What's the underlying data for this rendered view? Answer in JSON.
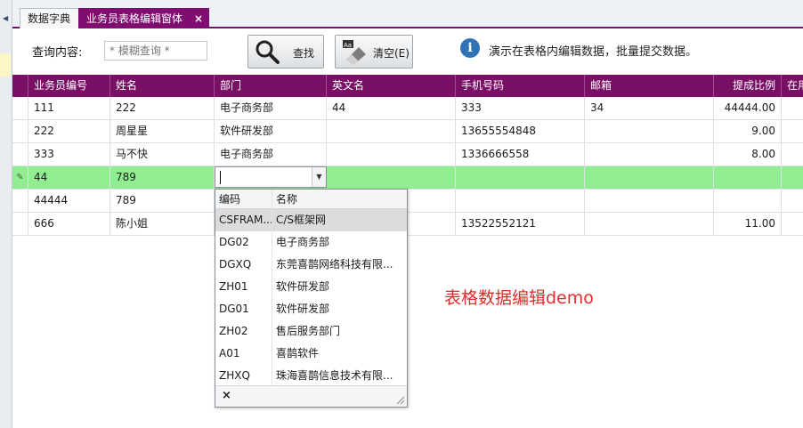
{
  "tabs": [
    {
      "label": "数据字典",
      "active": false
    },
    {
      "label": "业务员表格编辑窗体",
      "active": true,
      "close": "×"
    }
  ],
  "toolbar": {
    "query_label": "查询内容:",
    "query_placeholder": "* 模糊查询 *",
    "find_label": "查找",
    "clear_label": "清空(E)",
    "info_icon": "i",
    "info_text": "演示在表格内编辑数据，批量提交数据。"
  },
  "grid": {
    "columns": [
      "业务员编号",
      "姓名",
      "部门",
      "英文名",
      "手机号码",
      "邮箱",
      "提成比例",
      "在用"
    ],
    "rows": [
      {
        "id": "111",
        "name": "222",
        "dept": "电子商务部",
        "en": "44",
        "phone": "333",
        "email": "34",
        "rate": "44444.00",
        "inuse": ""
      },
      {
        "id": "222",
        "name": "周星星",
        "dept": "软件研发部",
        "en": "",
        "phone": "13655554848",
        "email": "",
        "rate": "9.00",
        "inuse": ""
      },
      {
        "id": "333",
        "name": "马不快",
        "dept": "电子商务部",
        "en": "",
        "phone": "1336666558",
        "email": "",
        "rate": "8.00",
        "inuse": ""
      },
      {
        "id": "44",
        "name": "789",
        "dept": "",
        "en": "",
        "phone": "",
        "email": "",
        "rate": "",
        "inuse": "",
        "editing": true
      },
      {
        "id": "44444",
        "name": "789",
        "dept": "",
        "en": "",
        "phone": "",
        "email": "",
        "rate": "",
        "inuse": ""
      },
      {
        "id": "666",
        "name": "陈小姐",
        "dept": "",
        "en": "",
        "phone": "13522552121",
        "email": "",
        "rate": "11.00",
        "inuse": ""
      }
    ],
    "active_row_color": "#90ee90",
    "header_color": "#7a0f66",
    "edit_indicator": "✎"
  },
  "dept_popup": {
    "headers": [
      "编码",
      "名称"
    ],
    "items": [
      {
        "code": "CSFRAM...",
        "name": "C/S框架网",
        "selected": true
      },
      {
        "code": "DG02",
        "name": "电子商务部"
      },
      {
        "code": "DGXQ",
        "name": "东莞喜鹊网络科技有限..."
      },
      {
        "code": "ZH01",
        "name": "软件研发部"
      },
      {
        "code": "DG01",
        "name": "软件研发部"
      },
      {
        "code": "ZH02",
        "name": "售后服务部门"
      },
      {
        "code": "A01",
        "name": "喜鹊软件"
      },
      {
        "code": "ZHXQ",
        "name": "珠海喜鹊信息技术有限..."
      }
    ],
    "close_glyph": "×"
  },
  "demo_label": "表格数据编辑demo",
  "colors": {
    "accent": "#7a0f66",
    "demo_label": "#e52a2a",
    "info": "#2f73b6"
  }
}
